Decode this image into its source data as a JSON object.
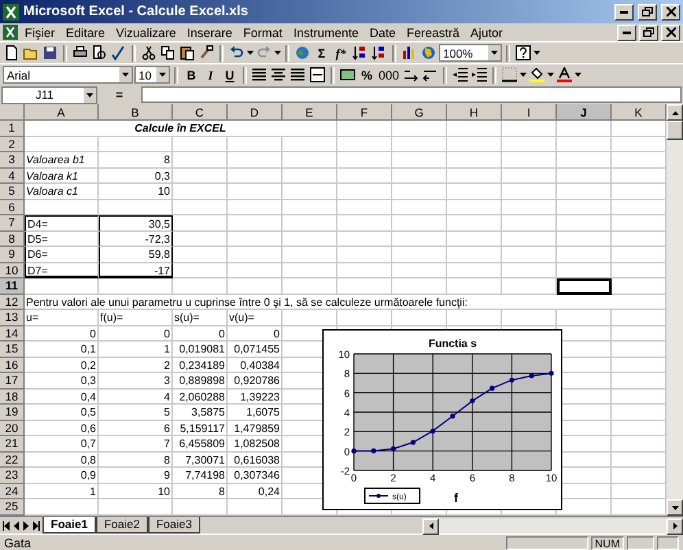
{
  "window": {
    "title": "Microsoft Excel - Calcule Excel.xls"
  },
  "menu": [
    "Fişier",
    "Editare",
    "Vizualizare",
    "Inserare",
    "Format",
    "Instrumente",
    "Date",
    "Fereastră",
    "Ajutor"
  ],
  "standard_toolbar": {
    "sum": "Σ",
    "function": "f*",
    "zoom": "100%"
  },
  "formatting_toolbar": {
    "font": "Arial",
    "size": "10",
    "bold": "B",
    "italic": "I",
    "underline": "U",
    "percent": "%",
    "thousands": "000"
  },
  "formula_bar": {
    "name_box": "J11",
    "equals": "="
  },
  "columns": [
    {
      "label": "A",
      "selected": false
    },
    {
      "label": "B",
      "selected": false
    },
    {
      "label": "C",
      "selected": false
    },
    {
      "label": "D",
      "selected": false
    },
    {
      "label": "E",
      "selected": false
    },
    {
      "label": "F",
      "selected": false
    },
    {
      "label": "G",
      "selected": false
    },
    {
      "label": "H",
      "selected": false
    },
    {
      "label": "I",
      "selected": false
    },
    {
      "label": "J",
      "selected": true
    },
    {
      "label": "K",
      "selected": false
    }
  ],
  "rows": [
    {
      "n": "1",
      "selected": false,
      "kind": "title",
      "text": "Calcule în EXCEL"
    },
    {
      "n": "2",
      "selected": false
    },
    {
      "n": "3",
      "selected": false,
      "kind": "param",
      "cells": [
        "Valoarea b1",
        "8"
      ]
    },
    {
      "n": "4",
      "selected": false,
      "kind": "param",
      "cells": [
        "Valoara k1",
        "0,3"
      ]
    },
    {
      "n": "5",
      "selected": false,
      "kind": "param",
      "cells": [
        "Valoara c1",
        "10"
      ]
    },
    {
      "n": "6",
      "selected": false
    },
    {
      "n": "7",
      "selected": false,
      "kind": "boxed",
      "cells": [
        "D4=",
        "30,5"
      ]
    },
    {
      "n": "8",
      "selected": false,
      "kind": "boxed",
      "cells": [
        "D5=",
        "-72,3"
      ]
    },
    {
      "n": "9",
      "selected": false,
      "kind": "boxed",
      "cells": [
        "D6=",
        "59,8"
      ]
    },
    {
      "n": "10",
      "selected": false,
      "kind": "boxed",
      "cells": [
        "D7=",
        "-17"
      ]
    },
    {
      "n": "11",
      "selected": true
    },
    {
      "n": "12",
      "selected": false,
      "kind": "note",
      "text": "Pentru valori ale unui parametru u cuprinse între 0 şi 1, să se calculeze următoarele funcţii:"
    },
    {
      "n": "13",
      "selected": false,
      "kind": "labels",
      "cells": [
        "u=",
        "f(u)=",
        "s(u)=",
        "v(u)="
      ]
    },
    {
      "n": "14",
      "selected": false,
      "kind": "values",
      "cells": [
        "0",
        "0",
        "0",
        "0"
      ]
    },
    {
      "n": "15",
      "selected": false,
      "kind": "values",
      "cells": [
        "0,1",
        "1",
        "0,019081",
        "0,071455"
      ]
    },
    {
      "n": "16",
      "selected": false,
      "kind": "values",
      "cells": [
        "0,2",
        "2",
        "0,234189",
        "0,40384"
      ]
    },
    {
      "n": "17",
      "selected": false,
      "kind": "values",
      "cells": [
        "0,3",
        "3",
        "0,889898",
        "0,920786"
      ]
    },
    {
      "n": "18",
      "selected": false,
      "kind": "values",
      "cells": [
        "0,4",
        "4",
        "2,060288",
        "1,39223"
      ]
    },
    {
      "n": "19",
      "selected": false,
      "kind": "values",
      "cells": [
        "0,5",
        "5",
        "3,5875",
        "1,6075"
      ]
    },
    {
      "n": "20",
      "selected": false,
      "kind": "values",
      "cells": [
        "0,6",
        "6",
        "5,159117",
        "1,479859"
      ]
    },
    {
      "n": "21",
      "selected": false,
      "kind": "values",
      "cells": [
        "0,7",
        "7",
        "6,455809",
        "1,082508"
      ]
    },
    {
      "n": "22",
      "selected": false,
      "kind": "values",
      "cells": [
        "0,8",
        "8",
        "7,30071",
        "0,616038"
      ]
    },
    {
      "n": "23",
      "selected": false,
      "kind": "values",
      "cells": [
        "0,9",
        "9",
        "7,74198",
        "0,307346"
      ]
    },
    {
      "n": "24",
      "selected": false,
      "kind": "values",
      "cells": [
        "1",
        "10",
        "8",
        "0,24"
      ]
    },
    {
      "n": "25",
      "selected": false
    }
  ],
  "chart": {
    "chart_data": {
      "type": "line",
      "title": "Functia s",
      "xlabel": "f",
      "x": [
        0,
        1,
        2,
        3,
        4,
        5,
        6,
        7,
        8,
        9,
        10
      ],
      "series": [
        {
          "name": "s(u)",
          "color": "#000080",
          "marker": "circle",
          "values": [
            0,
            0.02,
            0.23,
            0.89,
            2.06,
            3.59,
            5.16,
            6.46,
            7.3,
            7.74,
            8
          ]
        }
      ],
      "grid": true,
      "xlim": [
        0,
        10
      ],
      "ylim": [
        -2,
        10
      ],
      "xticks": [
        0,
        2,
        4,
        6,
        8,
        10
      ],
      "yticks": [
        -2,
        0,
        2,
        4,
        6,
        8,
        10
      ]
    }
  },
  "sheet_tabs": [
    {
      "label": "Foaie1",
      "selected": true
    },
    {
      "label": "Foaie2",
      "selected": false
    },
    {
      "label": "Foaie3",
      "selected": false
    }
  ],
  "status_bar": {
    "text": "Gata",
    "num": "NUM"
  }
}
